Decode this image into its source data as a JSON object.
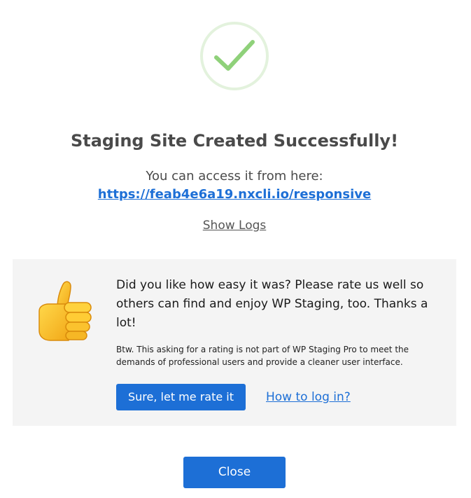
{
  "success": {
    "icon": "checkmark-circle-icon",
    "title": "Staging Site Created Successfully!",
    "access_text": "You can access it from here:",
    "site_url": "https://feab4e6a19.nxcli.io/responsive",
    "show_logs_label": "Show Logs"
  },
  "rating": {
    "icon": "thumbs-up-icon",
    "message": "Did you like how easy it was? Please rate us well so others can find and enjoy WP Staging, too. Thanks a lot!",
    "note": "Btw. This asking for a rating is not part of WP Staging Pro to meet the demands of professional users and provide a cleaner user interface.",
    "rate_button_label": "Sure, let me rate it",
    "login_link_label": "How to log in?"
  },
  "footer": {
    "close_label": "Close"
  },
  "colors": {
    "accent": "#1d6fd6",
    "success_green": "#8fd17a",
    "success_ring": "#e3f2dd",
    "panel_bg": "#f4f4f4"
  }
}
